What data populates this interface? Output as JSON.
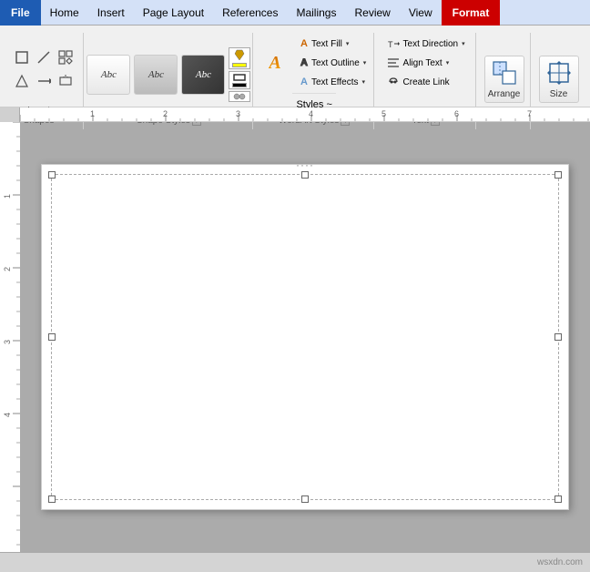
{
  "menubar": {
    "file": "File",
    "home": "Home",
    "insert": "Insert",
    "page_layout": "Page Layout",
    "references": "References",
    "mailings": "Mailings",
    "review": "Review",
    "view": "View",
    "format": "Format"
  },
  "ribbon": {
    "insert_shapes": {
      "label": "Insert Shapes",
      "shapes_icon": "□",
      "expand_icon": "▾"
    },
    "shape_styles": {
      "label": "Shape Styles",
      "btn1": "Abc",
      "btn2": "Abc",
      "btn3": "Abc",
      "expand_icon": "▾"
    },
    "wordart_styles": {
      "label": "WordArt Styles",
      "letter_a": "A",
      "text_fill_label": "Text Fill",
      "text_outline_label": "Text Outline",
      "text_effects_label": "Text Effects",
      "styles_dropdown": "Styles ~",
      "expand_icon": "▾"
    },
    "text": {
      "label": "Text",
      "direction_label": "Text Direction",
      "align_label": "Align Text",
      "create_link_label": "Create Link",
      "expand_icon": "▾"
    },
    "arrange": {
      "label": "Arrange",
      "icon": "⊞"
    },
    "size": {
      "label": "Size",
      "icon": "⇔"
    }
  },
  "ruler": {
    "unit": "inches"
  },
  "status_bar": {
    "text": "wsxdn.com"
  }
}
